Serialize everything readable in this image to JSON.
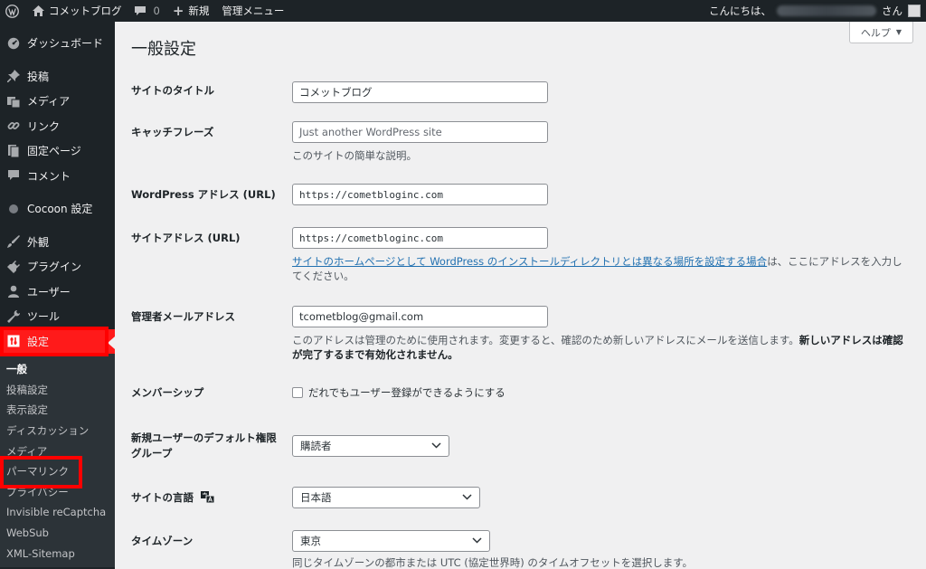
{
  "adminbar": {
    "site_name": "コメットブログ",
    "comments_count": "0",
    "new_label": "新規",
    "admin_menu_label": "管理メニュー",
    "greeting": "こんにちは、",
    "honorific": "さん"
  },
  "sidebar": {
    "items": [
      {
        "label": "ダッシュボード",
        "icon": "dashboard-icon"
      },
      {
        "label": "投稿",
        "icon": "pin-icon"
      },
      {
        "label": "メディア",
        "icon": "media-icon"
      },
      {
        "label": "リンク",
        "icon": "link-icon"
      },
      {
        "label": "固定ページ",
        "icon": "page-icon"
      },
      {
        "label": "コメント",
        "icon": "comment-icon"
      },
      {
        "label": "Cocoon 設定",
        "icon": "cocoon-icon"
      },
      {
        "label": "外観",
        "icon": "appearance-icon"
      },
      {
        "label": "プラグイン",
        "icon": "plugin-icon"
      },
      {
        "label": "ユーザー",
        "icon": "user-icon"
      },
      {
        "label": "ツール",
        "icon": "wrench-icon"
      },
      {
        "label": "設定",
        "icon": "settings-icon"
      }
    ],
    "submenu": [
      "一般",
      "投稿設定",
      "表示設定",
      "ディスカッション",
      "メディア",
      "パーマリンク",
      "プライバシー",
      "Invisible reCaptcha",
      "WebSub",
      "XML-Sitemap"
    ]
  },
  "main": {
    "title": "一般設定",
    "help_label": "ヘルプ",
    "fields": {
      "site_title": {
        "label": "サイトのタイトル",
        "value": "コメットブログ"
      },
      "tagline": {
        "label": "キャッチフレーズ",
        "placeholder": "Just another WordPress site",
        "desc": "このサイトの簡単な説明。"
      },
      "wp_address": {
        "label": "WordPress アドレス (URL)",
        "value": "https://cometbloginc.com"
      },
      "site_address": {
        "label": "サイトアドレス (URL)",
        "value": "https://cometbloginc.com",
        "desc_link": "サイトのホームページとして WordPress のインストールディレクトリとは異なる場所を設定する場合",
        "desc_rest": "は、ここにアドレスを入力してください。"
      },
      "admin_email": {
        "label": "管理者メールアドレス",
        "value": "tcometblog@gmail.com",
        "desc": "このアドレスは管理のために使用されます。変更すると、確認のため新しいアドレスにメールを送信します。",
        "desc_bold": "新しいアドレスは確認が完了するまで有効化されません。"
      },
      "membership": {
        "label": "メンバーシップ",
        "checkbox": "だれでもユーザー登録ができるようにする"
      },
      "default_role": {
        "label": "新規ユーザーのデフォルト権限グループ",
        "value": "購読者"
      },
      "site_language": {
        "label": "サイトの言語",
        "value": "日本語"
      },
      "timezone": {
        "label": "タイムゾーン",
        "value": "東京",
        "desc": "同じタイムゾーンの都市または UTC (協定世界時) のタイムオフセットを選択します。"
      }
    }
  }
}
